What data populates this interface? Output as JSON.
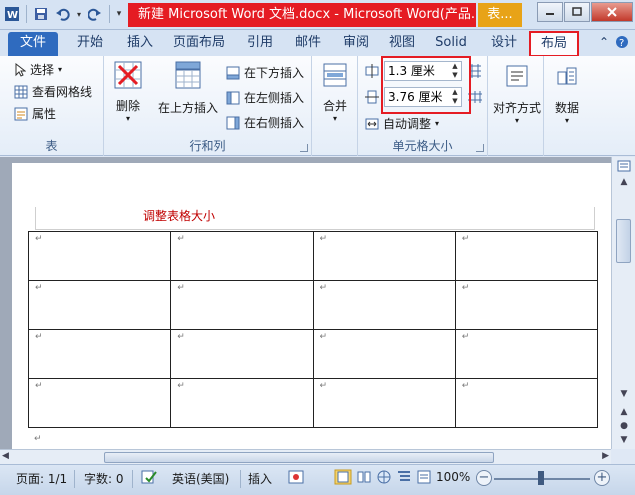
{
  "window": {
    "title": "新建 Microsoft Word 文档.docx - Microsoft Word(产品...",
    "context_tab": "表..."
  },
  "tabs": [
    "文件",
    "开始",
    "插入",
    "页面布局",
    "引用",
    "邮件",
    "审阅",
    "视图",
    "Solid",
    "设计",
    "布局"
  ],
  "ribbon": {
    "table_group": {
      "title": "表",
      "select": "选择",
      "view_gridlines": "查看网格线",
      "properties": "属性"
    },
    "rows_cols_group": {
      "title": "行和列",
      "delete": "删除",
      "insert_above": "在上方插入",
      "insert_below": "在下方插入",
      "insert_left": "在左侧插入",
      "insert_right": "在右侧插入"
    },
    "merge_group": {
      "merge": "合并"
    },
    "cell_size_group": {
      "title": "单元格大小",
      "height_value": "1.3 厘米",
      "width_value": "3.76 厘米",
      "autofit": "自动调整"
    },
    "align_group": {
      "label": "对齐方式"
    },
    "data_group": {
      "label": "数据"
    }
  },
  "document": {
    "caption": "调整表格大小",
    "rows": 4,
    "cols": 4,
    "para_mark": "↵"
  },
  "statusbar": {
    "page": "页面: 1/1",
    "words": "字数: 0",
    "language": "英语(美国)",
    "mode": "插入",
    "zoom": "100%"
  },
  "colors": {
    "accent": "#2f6bbf",
    "highlight": "#e51c23",
    "caption": "#c00000"
  }
}
